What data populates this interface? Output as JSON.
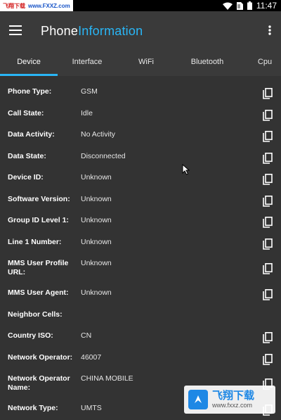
{
  "status_bar": {
    "watermark_cn": "飞翔下载",
    "watermark_url": "www.FXXZ.com",
    "time": "11:47"
  },
  "app_bar": {
    "title_part1": "Phone",
    "title_part2": "Information",
    "accent_color": "#29b6f6"
  },
  "tabs": [
    {
      "label": "Device",
      "active": true
    },
    {
      "label": "Interface",
      "active": false
    },
    {
      "label": "WiFi",
      "active": false
    },
    {
      "label": "Bluetooth",
      "active": false
    },
    {
      "label": "Cpu",
      "active": false
    }
  ],
  "rows": [
    {
      "label": "Phone Type:",
      "value": "GSM",
      "copy": true
    },
    {
      "label": "Call State:",
      "value": "Idle",
      "copy": true
    },
    {
      "label": "Data Activity:",
      "value": "No Activity",
      "copy": true
    },
    {
      "label": "Data State:",
      "value": "Disconnected",
      "copy": true
    },
    {
      "label": "Device ID:",
      "value": "Unknown",
      "copy": true
    },
    {
      "label": "Software Version:",
      "value": "Unknown",
      "copy": true
    },
    {
      "label": "Group ID Level 1:",
      "value": "Unknown",
      "copy": true
    },
    {
      "label": "Line 1 Number:",
      "value": "Unknown",
      "copy": true
    },
    {
      "label": "MMS User Profile URL:",
      "value": "Unknown",
      "copy": true
    },
    {
      "label": "MMS User Agent:",
      "value": "Unknown",
      "copy": true
    },
    {
      "label": "Neighbor Cells:",
      "value": "",
      "copy": false
    },
    {
      "label": "Country ISO:",
      "value": "CN",
      "copy": true
    },
    {
      "label": "Network Operator:",
      "value": "46007",
      "copy": true
    },
    {
      "label": "Network Operator Name:",
      "value": "CHINA MOBILE",
      "copy": true
    },
    {
      "label": "Network Type:",
      "value": "UMTS",
      "copy": true
    }
  ],
  "watermark_logo": {
    "cn": "飞翔下载",
    "url": "www.fxxz.com"
  },
  "icons": {
    "menu": "hamburger-menu-icon",
    "overflow": "more-vert-icon",
    "copy": "content-copy-icon",
    "wifi": "wifi-icon",
    "sim": "sim-card-icon",
    "battery": "battery-icon"
  }
}
